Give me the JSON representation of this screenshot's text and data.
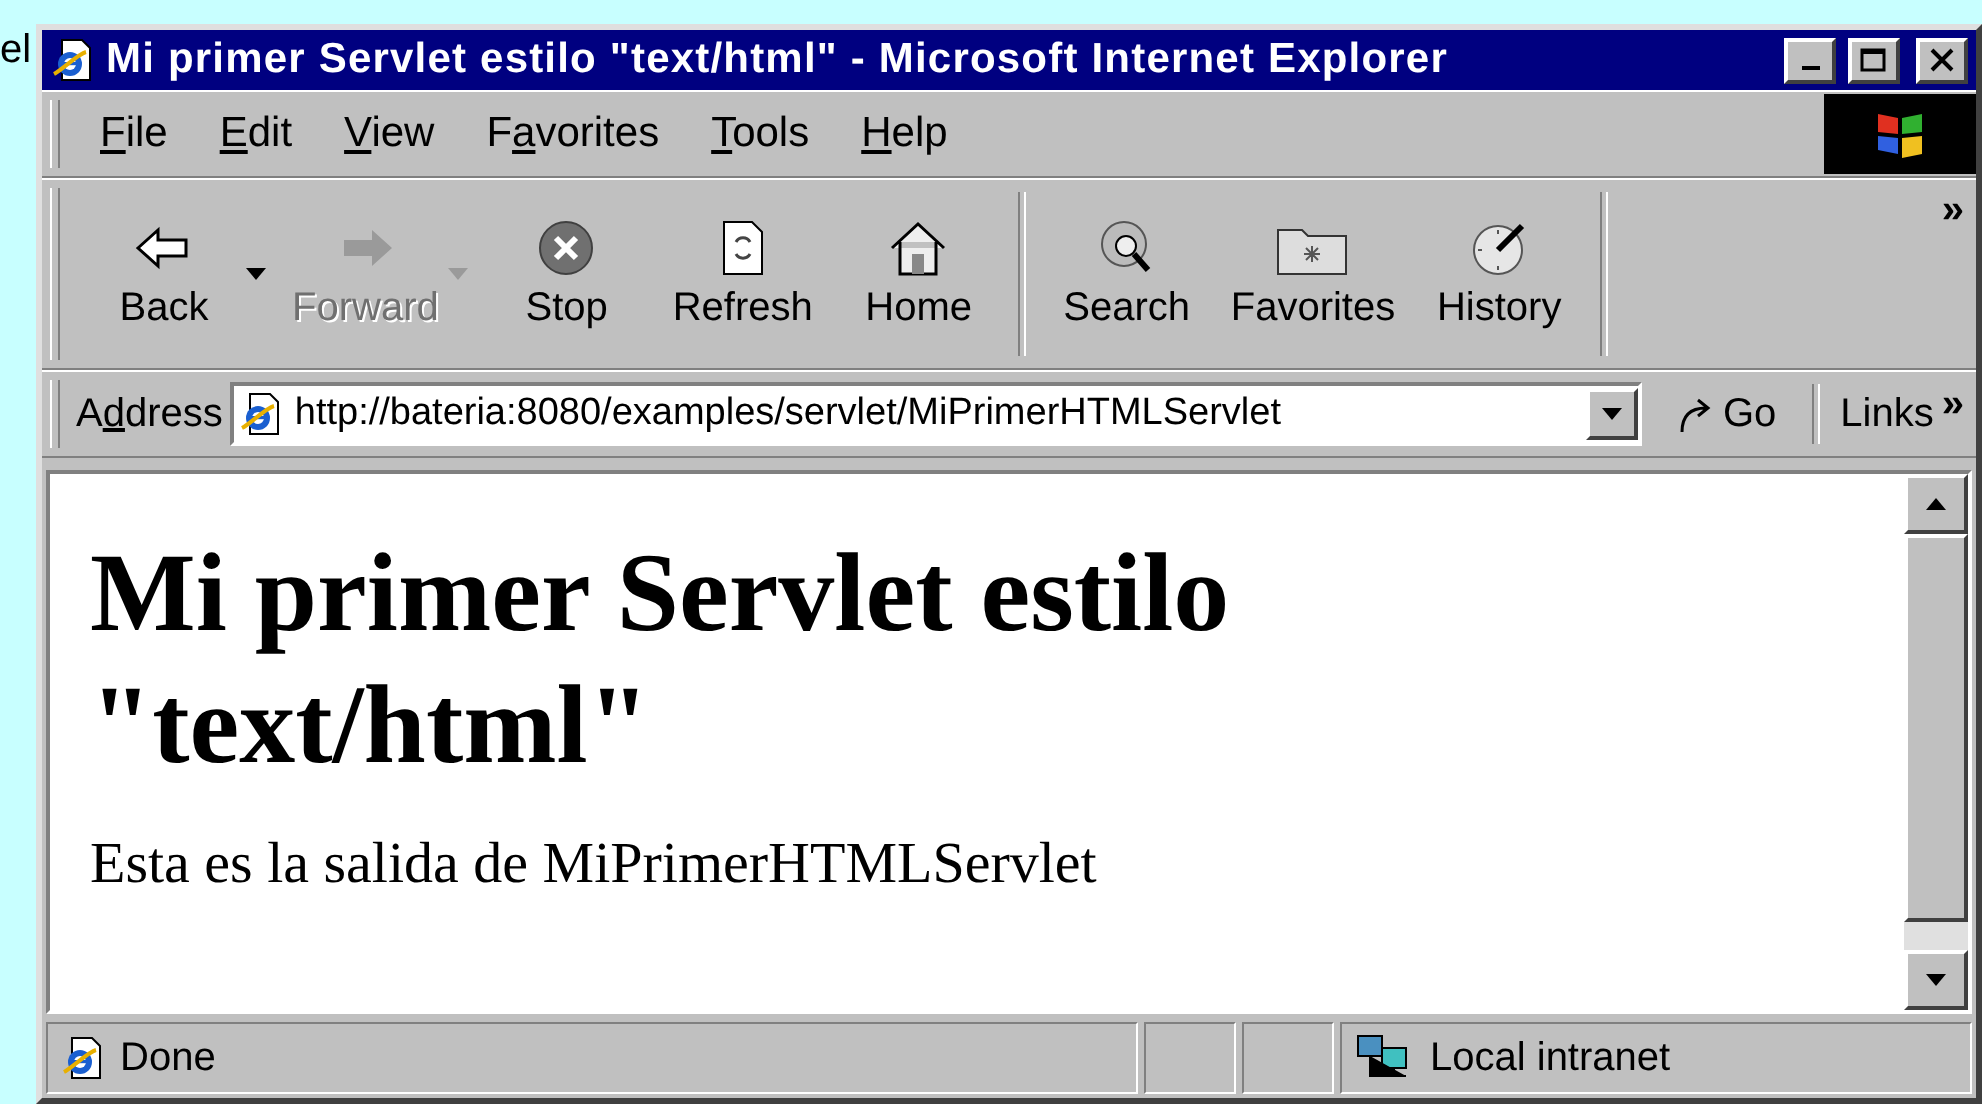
{
  "background": {
    "text": "el"
  },
  "window": {
    "title": "Mi primer Servlet estilo \"text/html\" - Microsoft Internet Explorer"
  },
  "menu": [
    {
      "access_key": "F",
      "after": "ile"
    },
    {
      "access_key": "E",
      "after": "dit"
    },
    {
      "access_key": "V",
      "after": "iew"
    },
    {
      "before": "F",
      "access_key": "a",
      "after": "vorites"
    },
    {
      "access_key": "T",
      "after": "ools"
    },
    {
      "access_key": "H",
      "after": "elp"
    }
  ],
  "toolbar": {
    "groups": [
      [
        {
          "kind": "back",
          "label": "Back",
          "disabled": false,
          "dropdown": true
        },
        {
          "kind": "forward",
          "label": "Forward",
          "disabled": true,
          "dropdown": true
        },
        {
          "kind": "stop",
          "label": "Stop",
          "disabled": false,
          "dropdown": false
        },
        {
          "kind": "refresh",
          "label": "Refresh",
          "disabled": false,
          "dropdown": false
        },
        {
          "kind": "home",
          "label": "Home",
          "disabled": false,
          "dropdown": false
        }
      ],
      [
        {
          "kind": "search",
          "label": "Search",
          "disabled": false,
          "dropdown": false
        },
        {
          "kind": "favorites",
          "label": "Favorites",
          "disabled": false,
          "dropdown": false
        },
        {
          "kind": "history",
          "label": "History",
          "disabled": false,
          "dropdown": false
        }
      ]
    ],
    "more": "»"
  },
  "address": {
    "before": "A",
    "access_key": "d",
    "after": "dress",
    "value": "http://bateria:8080/examples/servlet/MiPrimerHTMLServlet",
    "go": "Go",
    "links": "Links",
    "more": "»"
  },
  "content": {
    "heading": "Mi primer Servlet estilo \"text/html\"",
    "paragraph": "Esta es la salida de MiPrimerHTMLServlet"
  },
  "status_bar": {
    "text": "Done",
    "zone": "Local intranet"
  }
}
